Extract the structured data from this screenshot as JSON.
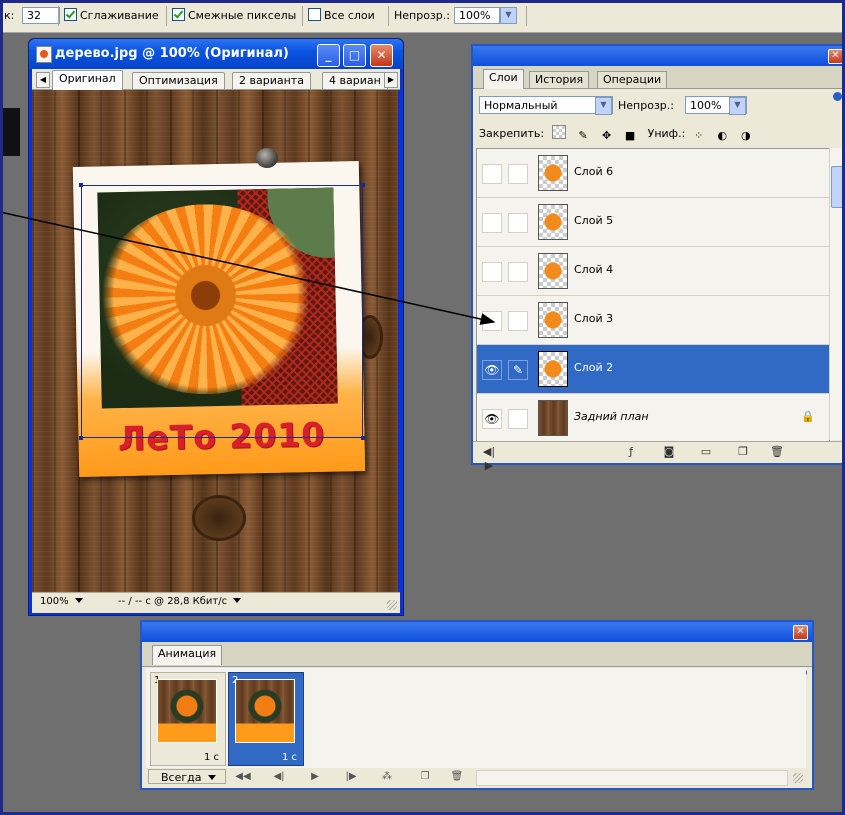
{
  "options_bar": {
    "tolerance_label": "к:",
    "tolerance_value": "32",
    "antialias_label": "Сглаживание",
    "contiguous_label": "Смежные пикселы",
    "all_layers_label": "Все слои",
    "opacity_label": "Непрозр.:",
    "opacity_value": "100%"
  },
  "document": {
    "title": "дерево.jpg @ 100% (Оригинал)",
    "tabs": [
      "Оригинал",
      "Оптимизация",
      "2 варианта",
      "4 вариан"
    ],
    "caption_text": "ЛеТо 2010",
    "zoom": "100%",
    "status_info": "-- / -- с @ 28,8 Кбит/с"
  },
  "layers_panel": {
    "tabs": [
      "Слои",
      "История",
      "Операции"
    ],
    "blend_mode": "Нормальный",
    "opacity_label": "Непрозр.:",
    "opacity_value": "100%",
    "lock_label": "Закрепить:",
    "unify_label": "Униф.:",
    "layers": [
      {
        "name": "Слой 6",
        "visible": false,
        "selected": false
      },
      {
        "name": "Слой 5",
        "visible": false,
        "selected": false
      },
      {
        "name": "Слой 4",
        "visible": false,
        "selected": false
      },
      {
        "name": "Слой 3",
        "visible": false,
        "selected": false
      },
      {
        "name": "Слой 2",
        "visible": true,
        "selected": true
      },
      {
        "name": "Задний план",
        "visible": true,
        "selected": false,
        "locked": true
      }
    ]
  },
  "animation_panel": {
    "tab": "Анимация",
    "frames": [
      {
        "number": "1",
        "delay": "1 с"
      },
      {
        "number": "2",
        "delay": "1 с"
      }
    ],
    "loop": "Всегда"
  },
  "colors": {
    "xp_blue": "#0831d9",
    "selection": "#316ac5",
    "panel": "#ece9d8"
  }
}
